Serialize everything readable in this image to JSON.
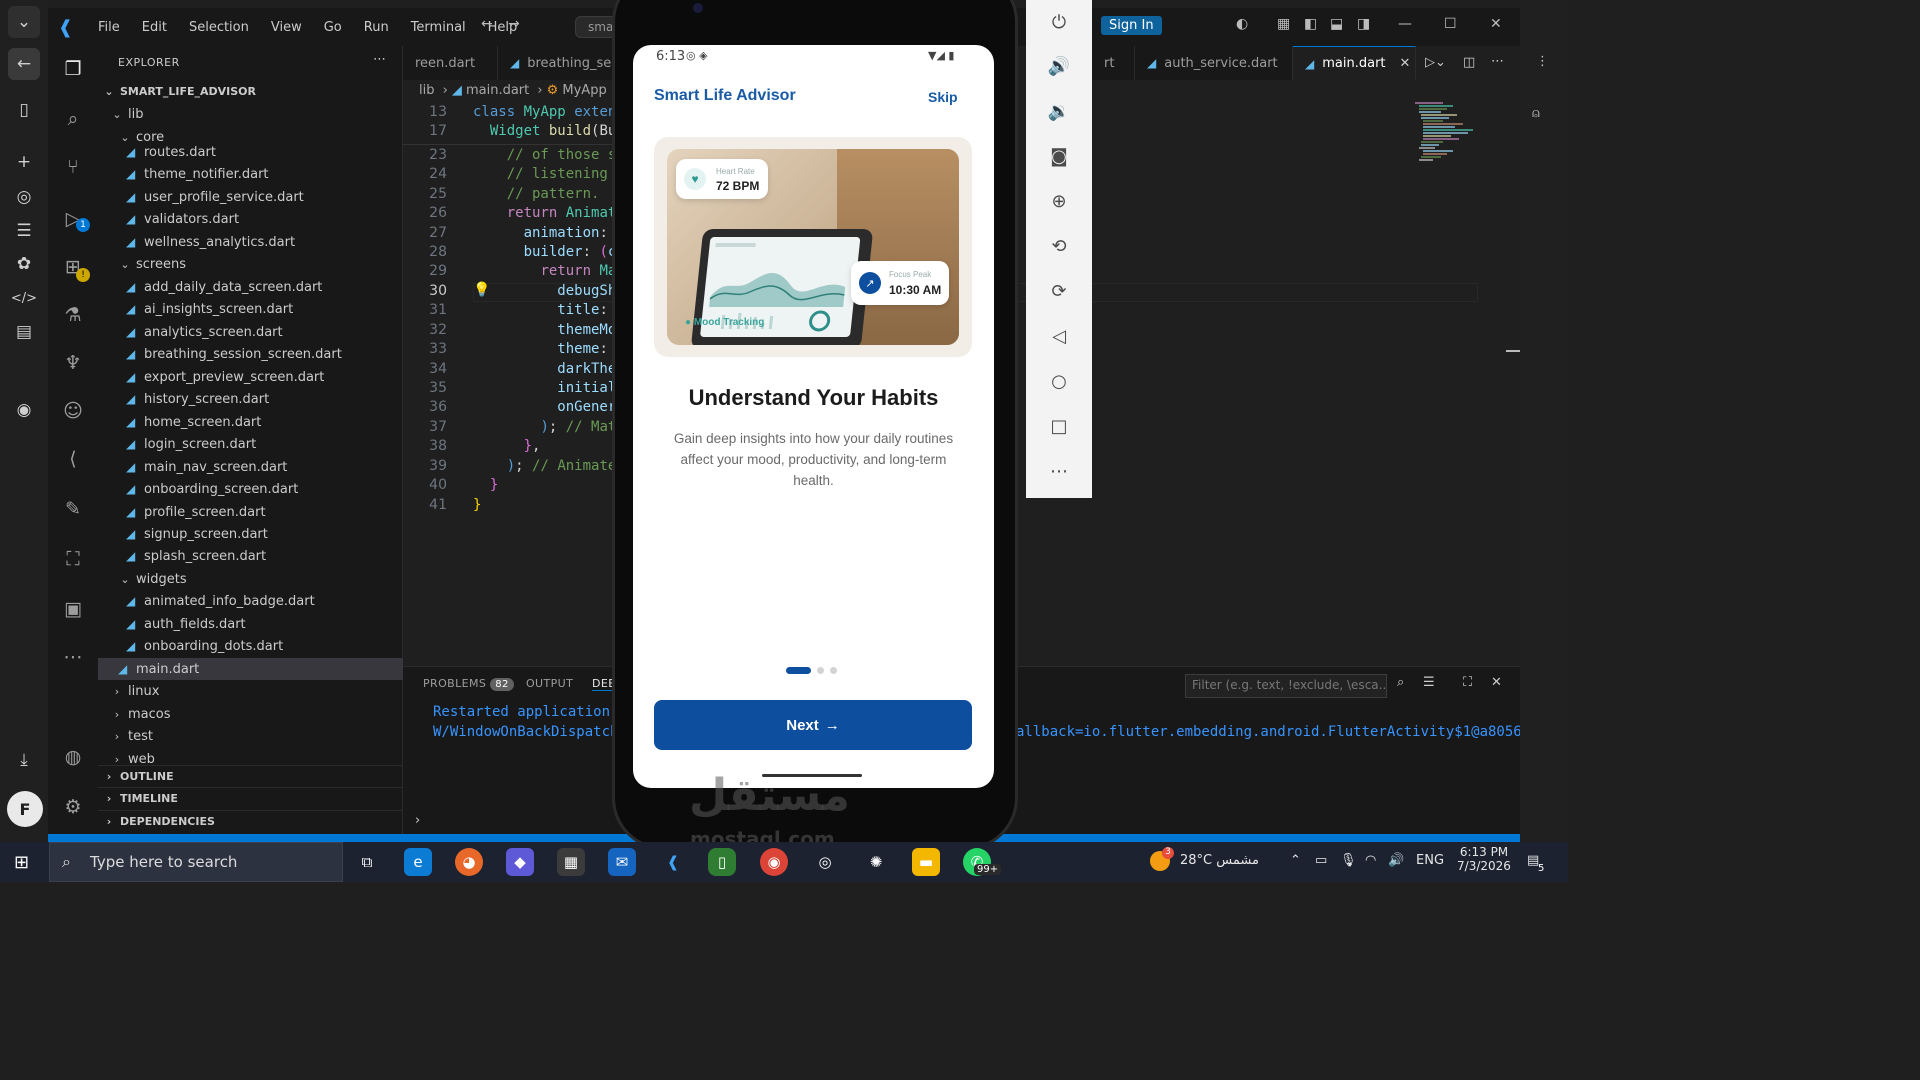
{
  "titlebar": {
    "menus": [
      "File",
      "Edit",
      "Selection",
      "View",
      "Go",
      "Run",
      "Terminal",
      "Help"
    ],
    "command_search": "smart_life_ad",
    "sign_in": "Sign In"
  },
  "explorer": {
    "header": "EXPLORER",
    "root": "SMART_LIFE_ADVISOR",
    "lib": "lib",
    "core": "core",
    "core_files": [
      "routes.dart",
      "theme_notifier.dart",
      "user_profile_service.dart",
      "validators.dart",
      "wellness_analytics.dart"
    ],
    "screens": "screens",
    "screen_files": [
      "add_daily_data_screen.dart",
      "ai_insights_screen.dart",
      "analytics_screen.dart",
      "breathing_session_screen.dart",
      "export_preview_screen.dart",
      "history_screen.dart",
      "home_screen.dart",
      "login_screen.dart",
      "main_nav_screen.dart",
      "onboarding_screen.dart",
      "profile_screen.dart",
      "signup_screen.dart",
      "splash_screen.dart"
    ],
    "widgets": "widgets",
    "widget_files": [
      "animated_info_badge.dart",
      "auth_fields.dart",
      "onboarding_dots.dart"
    ],
    "main_file": "main.dart",
    "folders": [
      "linux",
      "macos",
      "test",
      "web"
    ],
    "sections": [
      "OUTLINE",
      "TIMELINE",
      "DEPENDENCIES"
    ]
  },
  "activity_badges": {
    "run": "1"
  },
  "avatar_letter": "F",
  "tabs": [
    {
      "label": "reen.dart"
    },
    {
      "label": "breathing_sessio"
    },
    {
      "label": "rt"
    },
    {
      "label": "auth_service.dart"
    },
    {
      "label": "main.dart",
      "active": true
    }
  ],
  "breadcrumb": {
    "a": "lib",
    "b": "main.dart",
    "c": "MyApp"
  },
  "code": [
    {
      "n": "13",
      "t": "class MyApp extend"
    },
    {
      "n": "17",
      "t": "  Widget build(Bui"
    },
    {
      "n": "23",
      "t": "    // of those sc"
    },
    {
      "n": "24",
      "t": "    // listening t"
    },
    {
      "n": "25",
      "t": "    // pattern."
    },
    {
      "n": "26",
      "t": "    return Animate"
    },
    {
      "n": "27",
      "t": "      animation: T"
    },
    {
      "n": "28",
      "t": "      builder: (co"
    },
    {
      "n": "29",
      "t": "        return Mat"
    },
    {
      "n": "30",
      "t": "          debugSho"
    },
    {
      "n": "31",
      "t": "          title: '"
    },
    {
      "n": "32",
      "t": "          themeMod"
    },
    {
      "n": "33",
      "t": "          theme: A"
    },
    {
      "n": "34",
      "t": "          darkThem"
    },
    {
      "n": "35",
      "t": "          initialR"
    },
    {
      "n": "36",
      "t": "          onGenera"
    },
    {
      "n": "37",
      "t": "        ); // Mate"
    },
    {
      "n": "38",
      "t": "      },"
    },
    {
      "n": "39",
      "t": "    ); // Animated"
    },
    {
      "n": "40",
      "t": "  }"
    },
    {
      "n": "41",
      "t": "}"
    }
  ],
  "panel": {
    "problems": "PROBLEMS",
    "problems_count": "82",
    "output": "OUTPUT",
    "debug": "DEE",
    "filter_placeholder": "Filter (e.g. text, !exclude, \\esca...",
    "lines": [
      "Restarted application i",
      "W/WindowOnBackDispatche"
    ],
    "line2_tail": "allback=io.flutter.embedding.android.FlutterActivity$1@a805651"
  },
  "phone": {
    "time": "6:13",
    "app_title": "Smart Life Advisor",
    "skip": "Skip",
    "heart_label": "Heart Rate",
    "heart_value": "72 BPM",
    "focus_label": "Focus Peak",
    "focus_value": "10:30 AM",
    "mood_label": "Mood Tracking",
    "heading": "Understand Your Habits",
    "description": "Gain deep insights into how your daily routines affect your mood, productivity, and long-term health.",
    "next": "Next",
    "page_index": 1,
    "page_count": 3
  },
  "taskbar": {
    "search_placeholder": "Type here to search",
    "weather": "28°C  مشمس",
    "weather_badge": "3",
    "lang": "ENG",
    "time": "6:13 PM",
    "date": "7/3/2026",
    "whatsapp_badge": "99+",
    "notif_count": "5"
  },
  "watermark": {
    "main": "مستقل",
    "sub": "mostaql.com"
  },
  "colors": {
    "accent": "#0078d4",
    "app_blue": "#0d4f9e",
    "dart_blue": "#5fb6e8"
  }
}
